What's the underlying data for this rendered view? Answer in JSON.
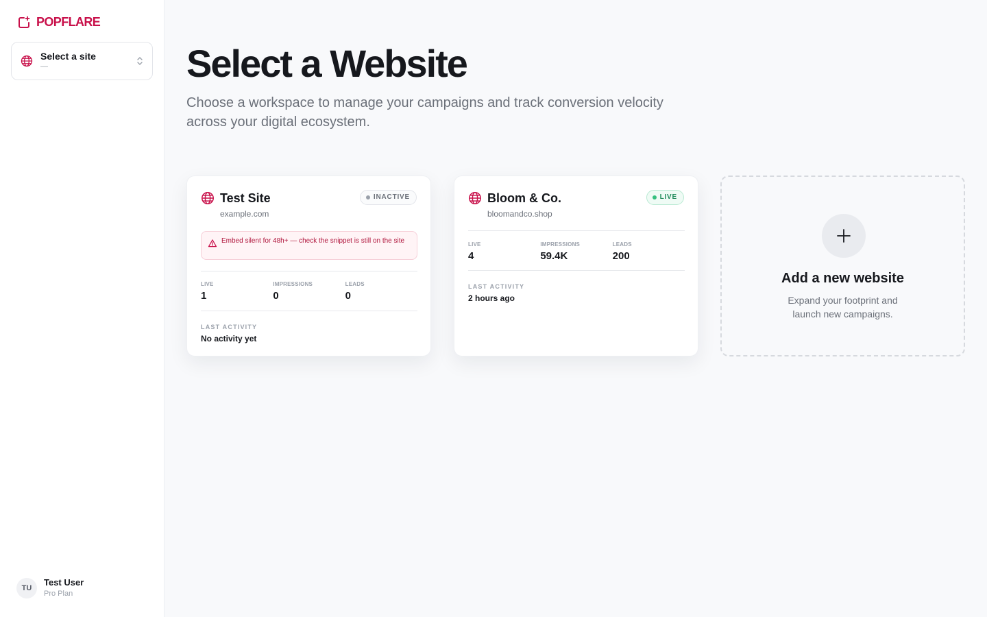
{
  "brand": {
    "name": "POPFLARE",
    "color": "#c8104a"
  },
  "site_picker": {
    "title": "Select a site",
    "subtitle": "—"
  },
  "user": {
    "initials": "TU",
    "name": "Test User",
    "plan": "Pro Plan"
  },
  "header": {
    "title": "Select a Website",
    "subtitle": "Choose a workspace to manage your campaigns and track conversion velocity across your digital ecosystem."
  },
  "sites": [
    {
      "name": "Test Site",
      "domain": "example.com",
      "status": "INACTIVE",
      "alert": "Embed silent for 48h+ — check the snippet is still on the site",
      "stats": [
        {
          "label": "LIVE",
          "value": "1"
        },
        {
          "label": "IMPRESSIONS",
          "value": "0"
        },
        {
          "label": "LEADS",
          "value": "0"
        }
      ],
      "activity_label": "LAST ACTIVITY",
      "activity": "No activity yet"
    },
    {
      "name": "Bloom & Co.",
      "domain": "bloomandco.shop",
      "status": "LIVE",
      "stats": [
        {
          "label": "LIVE",
          "value": "4"
        },
        {
          "label": "IMPRESSIONS",
          "value": "59.4K"
        },
        {
          "label": "LEADS",
          "value": "200"
        }
      ],
      "activity_label": "LAST ACTIVITY",
      "activity": "2 hours ago"
    }
  ],
  "add_site": {
    "title": "Add a new website",
    "subtitle": "Expand your footprint and launch new campaigns."
  },
  "icons": {
    "logo": "sparkle-square-icon",
    "globe": "globe-icon",
    "chevrons": "chevron-up-down-icon",
    "alert": "warning-triangle-icon",
    "add": "plus-icon"
  },
  "colors": {
    "accent": "#c8104a",
    "live": "#34c07e",
    "inactive": "#9aa0aa",
    "alert_bg": "#fff4f6"
  }
}
